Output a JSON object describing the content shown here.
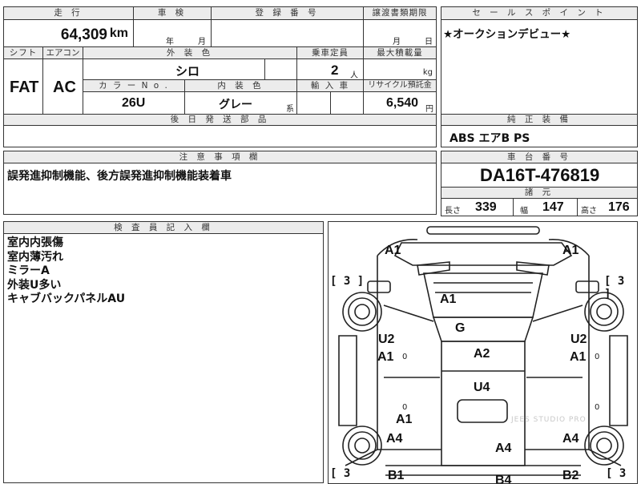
{
  "top": {
    "mileage_header": "走 行",
    "mileage_value": "64,309",
    "mileage_unit": "km",
    "inspection_header": "車 検",
    "inspection_year": "年",
    "inspection_month": "月",
    "registration_header": "登 録 番 号",
    "transfer_header": "譲渡書類期限",
    "transfer_month": "月",
    "transfer_day": "日"
  },
  "specs": {
    "shift_header": "シフト",
    "shift_value": "FAT",
    "ac_header": "エアコン",
    "ac_value": "AC",
    "exterior_color_header": "外 装 色",
    "exterior_color_value": "シロ",
    "capacity_header": "乗車定員",
    "capacity_value": "2",
    "capacity_unit": "人",
    "max_load_header": "最大積載量",
    "max_load_unit": "kg",
    "color_no_header": "カ ラ ー N o .",
    "color_no_value": "26U",
    "interior_color_header": "内 装 色",
    "interior_color_value": "グレー",
    "interior_color_suffix": "系",
    "import_header": "輸 入 車",
    "recycle_header": "リサイクル預託金",
    "recycle_value": "6,540",
    "recycle_unit": "円",
    "later_parts_header": "後 日 発 送 部 品"
  },
  "sales_point": {
    "header": "セ ー ル ス ポ イ ン ト",
    "text": "★オークションデビュー★"
  },
  "genuine_equipment": {
    "header": "純 正 装 備",
    "text": "ABS エアB PS"
  },
  "notes": {
    "header": "注 意 事 項 欄",
    "text": "誤発進抑制機能、後方誤発進抑制機能装着車"
  },
  "chassis": {
    "header": "車 台 番 号",
    "value": "DA16T-476819",
    "spec_header": "諸 元",
    "length_label": "長さ",
    "length_value": "339",
    "width_label": "幅",
    "width_value": "147",
    "height_label": "高さ",
    "height_value": "176"
  },
  "inspector": {
    "header": "検 査 員 記 入 欄",
    "lines": [
      "室内内張傷",
      "室内薄汚れ",
      "ミラーA",
      "外装U多い",
      "キャブバックパネルAU"
    ]
  },
  "diagram": {
    "watermark": "JEES STUDIO PRO",
    "labels": {
      "front_left": "A1",
      "front_right": "A1",
      "bracket_tl": "[ 3 ]",
      "bracket_tr": "[ 3 ]",
      "bracket_bl": "[ 3",
      "bracket_br": "[ 3",
      "windshield": "A1",
      "roof": "G",
      "left_u2": "U2",
      "left_a1": "A1",
      "right_u2": "U2",
      "right_a1": "A1",
      "hood_a2": "A2",
      "bed_u4": "U4",
      "mid_a1": "A1",
      "left_a4": "A4",
      "right_a4": "A4",
      "center_a4": "A4",
      "rear_left_b1": "B1",
      "rear_right_b2": "B2",
      "rear_b4": "B4",
      "zero": "0"
    }
  }
}
